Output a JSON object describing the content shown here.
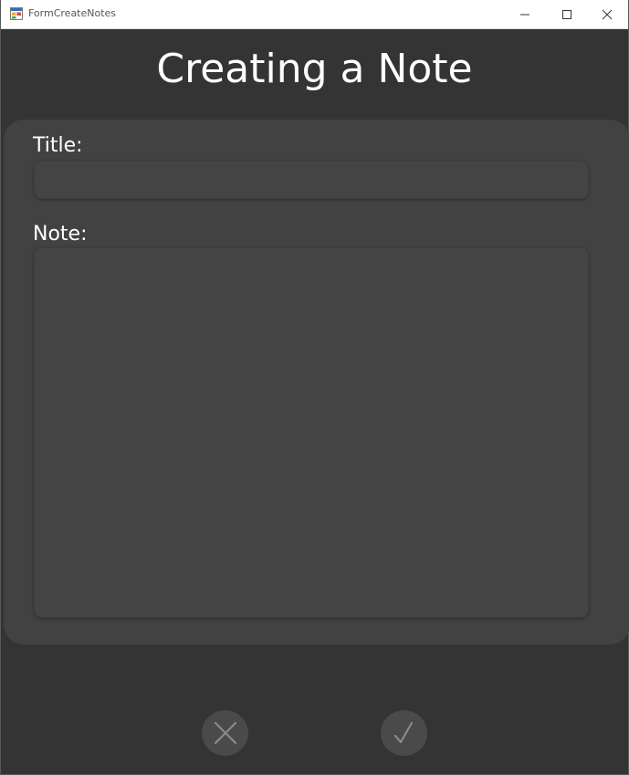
{
  "window": {
    "title": "FormCreateNotes",
    "icons": {
      "app": "app-form-icon",
      "minimize": "minimize-icon",
      "maximize": "maximize-icon",
      "close": "close-icon"
    }
  },
  "page": {
    "heading": "Creating a Note"
  },
  "form": {
    "title_label": "Title:",
    "title_value": "",
    "note_label": "Note:",
    "note_value": ""
  },
  "actions": {
    "cancel_icon": "x-icon",
    "confirm_icon": "checkmark-icon"
  },
  "colors": {
    "background": "#343434",
    "panel": "#424242",
    "field": "#444444",
    "text": "#ffffff",
    "action_button": "#4a4a4a",
    "action_glyph": "#8a8a8a"
  }
}
